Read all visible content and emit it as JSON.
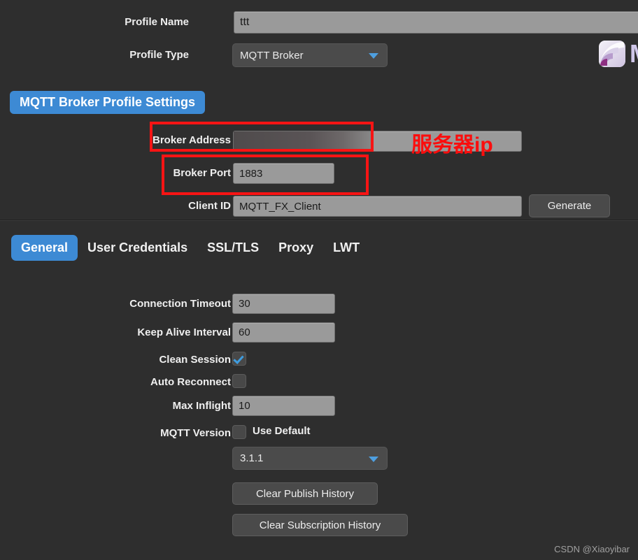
{
  "window": {
    "background_color": "#2e2e2e",
    "accent_color": "#3d8ad4",
    "annotation_color": "#f71414"
  },
  "header": {
    "profile_name_label": "Profile Name",
    "profile_name_value": "ttt",
    "profile_name_placeholder": "Profile Name",
    "profile_type_label": "Profile Type",
    "profile_type_value": "MQTT Broker",
    "app_icon_letter": "M"
  },
  "section": {
    "badge_label": "MQTT Broker Profile Settings"
  },
  "broker": {
    "address_label": "Broker Address",
    "address_value": "",
    "address_placeholder": "",
    "port_label": "Broker Port",
    "port_value": "1883",
    "client_id_label": "Client ID",
    "client_id_value": "MQTT_FX_Client",
    "generate_label": "Generate"
  },
  "annotations": {
    "server_ip_text": "服务器ip"
  },
  "tabs": [
    {
      "label": "General",
      "active": true
    },
    {
      "label": "User Credentials",
      "active": false
    },
    {
      "label": "SSL/TLS",
      "active": false
    },
    {
      "label": "Proxy",
      "active": false
    },
    {
      "label": "LWT",
      "active": false
    }
  ],
  "general": {
    "connection_timeout_label": "Connection Timeout",
    "connection_timeout_value": "30",
    "keep_alive_label": "Keep Alive Interval",
    "keep_alive_value": "60",
    "clean_session_label": "Clean Session",
    "clean_session_checked": true,
    "auto_reconnect_label": "Auto Reconnect",
    "auto_reconnect_checked": false,
    "max_inflight_label": "Max Inflight",
    "max_inflight_value": "10",
    "mqtt_version_label": "MQTT Version",
    "use_default_label": "Use Default",
    "use_default_checked": false,
    "mqtt_version_value": "3.1.1",
    "clear_publish_label": "Clear Publish History",
    "clear_subscription_label": "Clear Subscription History"
  },
  "footer": {
    "watermark": "CSDN @Xiaoyibar"
  }
}
